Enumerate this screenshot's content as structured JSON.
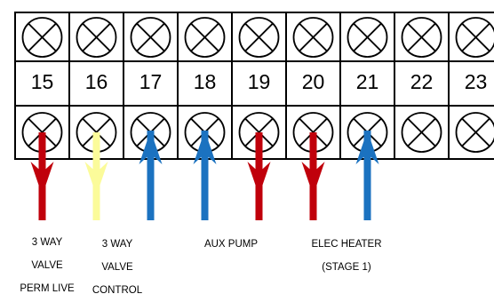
{
  "terminals": [
    {
      "number": "15"
    },
    {
      "number": "16"
    },
    {
      "number": "17"
    },
    {
      "number": "18"
    },
    {
      "number": "19"
    },
    {
      "number": "20"
    },
    {
      "number": "21"
    },
    {
      "number": "22"
    },
    {
      "number": "23"
    }
  ],
  "wires": [
    {
      "terminal": "15",
      "color": "#c0000b",
      "direction": "into-terminal-block-from-below-pointing-down"
    },
    {
      "terminal": "16",
      "color": "#fbfb9a",
      "direction": "pointing-down"
    },
    {
      "terminal": "17",
      "color": "#1b72c0",
      "direction": "pointing-up"
    },
    {
      "terminal": "18",
      "color": "#1b72c0",
      "direction": "pointing-up"
    },
    {
      "terminal": "19",
      "color": "#c0000b",
      "direction": "pointing-down"
    },
    {
      "terminal": "20",
      "color": "#c0000b",
      "direction": "pointing-down"
    },
    {
      "terminal": "21",
      "color": "#1b72c0",
      "direction": "pointing-up"
    }
  ],
  "labels": [
    {
      "lines": [
        "3 WAY",
        "VALVE",
        "PERM LIVE"
      ]
    },
    {
      "lines": [
        "3 WAY",
        "VALVE",
        "CONTROL"
      ]
    },
    {
      "lines": [
        "AUX PUMP"
      ]
    },
    {
      "lines": [
        "ELEC HEATER",
        "(STAGE 1)"
      ]
    }
  ],
  "colors": {
    "live": "#c0000b",
    "control": "#fbfb9a",
    "return": "#1b72c0",
    "outline": "#000000"
  },
  "icons": {
    "terminal_screw": "circle-with-x-screw-icon",
    "arrow_down": "arrow-down-icon",
    "arrow_up": "arrow-up-icon"
  }
}
